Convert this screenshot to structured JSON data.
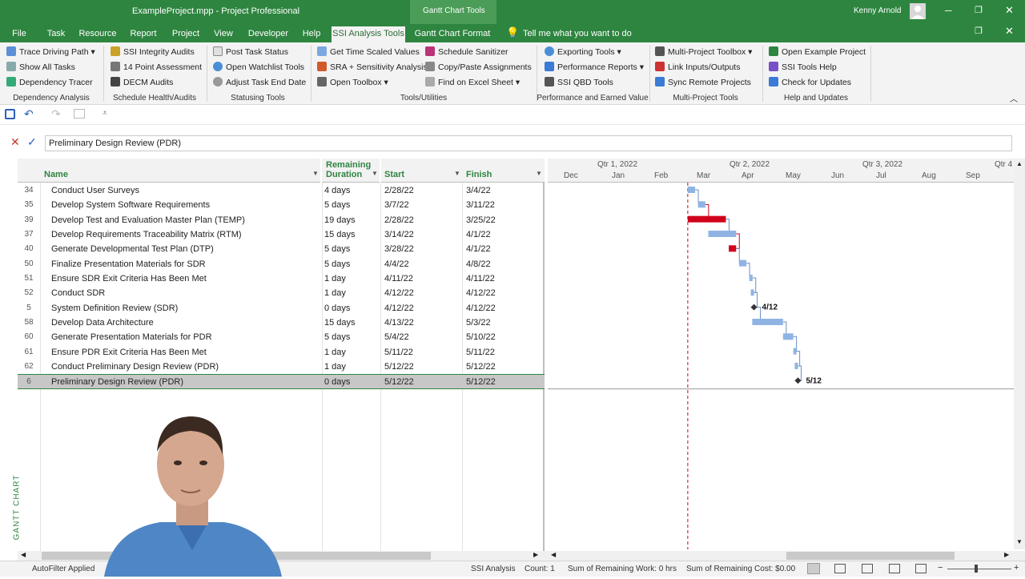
{
  "window": {
    "title": "ExampleProject.mpp  -  Project Professional",
    "context_tab_group": "Gantt Chart Tools",
    "user": "Kenny Arnold"
  },
  "tabs": [
    {
      "label": "File"
    },
    {
      "label": "Task"
    },
    {
      "label": "Resource"
    },
    {
      "label": "Report"
    },
    {
      "label": "Project"
    },
    {
      "label": "View"
    },
    {
      "label": "Developer"
    },
    {
      "label": "Help"
    },
    {
      "label": "SSI Analysis Tools",
      "active": true
    },
    {
      "label": "Gantt Chart Format"
    }
  ],
  "tell_me": "Tell me what you want to do",
  "ribbon": {
    "groups": [
      {
        "label": "Dependency Analysis",
        "items": [
          "Trace Driving Path",
          "Show All Tasks",
          "Dependency Tracer"
        ]
      },
      {
        "label": "Schedule Health/Audits",
        "items": [
          "SSI Integrity Audits",
          "14 Point Assessment",
          "DECM Audits"
        ]
      },
      {
        "label": "Statusing Tools",
        "items": [
          "Post Task Status",
          "Open Watchlist Tools",
          "Adjust Task End Date"
        ]
      },
      {
        "label": "Tools/Utilities",
        "items": [
          "Get Time Scaled Values",
          "SRA + Sensitivity Analysis",
          "Open Toolbox",
          "Schedule Sanitizer",
          "Copy/Paste Assignments",
          "Find on Excel Sheet"
        ]
      },
      {
        "label": "Performance and Earned Value",
        "items": [
          "Exporting Tools",
          "Performance Reports",
          "SSI QBD Tools"
        ]
      },
      {
        "label": "Multi-Project Tools",
        "items": [
          "Multi-Project Toolbox",
          "Link Inputs/Outputs",
          "Sync Remote Projects"
        ]
      },
      {
        "label": "Help and Updates",
        "items": [
          "Open Example Project",
          "SSI Tools Help",
          "Check for Updates"
        ]
      }
    ]
  },
  "entry_bar": {
    "value": "Preliminary Design Review (PDR)"
  },
  "view_label": "GANTT CHART",
  "table": {
    "columns": {
      "name": "Name",
      "remaining": "Remaining Duration",
      "start": "Start",
      "finish": "Finish"
    },
    "rows": [
      {
        "id": "34",
        "name": "Conduct User Surveys",
        "remaining": "4 days",
        "start": "2/28/22",
        "finish": "3/4/22"
      },
      {
        "id": "35",
        "name": "Develop System Software Requirements",
        "remaining": "5 days",
        "start": "3/7/22",
        "finish": "3/11/22"
      },
      {
        "id": "39",
        "name": "Develop Test and Evaluation Master Plan (TEMP)",
        "remaining": "19 days",
        "start": "2/28/22",
        "finish": "3/25/22"
      },
      {
        "id": "37",
        "name": "Develop Requirements Traceability Matrix (RTM)",
        "remaining": "15 days",
        "start": "3/14/22",
        "finish": "4/1/22"
      },
      {
        "id": "40",
        "name": "Generate Developmental Test Plan (DTP)",
        "remaining": "5 days",
        "start": "3/28/22",
        "finish": "4/1/22"
      },
      {
        "id": "50",
        "name": "Finalize Presentation Materials for SDR",
        "remaining": "5 days",
        "start": "4/4/22",
        "finish": "4/8/22"
      },
      {
        "id": "51",
        "name": "Ensure SDR Exit Criteria Has Been Met",
        "remaining": "1 day",
        "start": "4/11/22",
        "finish": "4/11/22"
      },
      {
        "id": "52",
        "name": "Conduct SDR",
        "remaining": "1 day",
        "start": "4/12/22",
        "finish": "4/12/22"
      },
      {
        "id": "5",
        "name": "System Definition Review (SDR)",
        "remaining": "0 days",
        "start": "4/12/22",
        "finish": "4/12/22"
      },
      {
        "id": "58",
        "name": "Develop Data Architecture",
        "remaining": "15 days",
        "start": "4/13/22",
        "finish": "5/3/22"
      },
      {
        "id": "60",
        "name": "Generate Presentation Materials for PDR",
        "remaining": "5 days",
        "start": "5/4/22",
        "finish": "5/10/22"
      },
      {
        "id": "61",
        "name": "Ensure PDR Exit Criteria Has Been Met",
        "remaining": "1 day",
        "start": "5/11/22",
        "finish": "5/11/22"
      },
      {
        "id": "62",
        "name": "Conduct Preliminary Design Review (PDR)",
        "remaining": "1 day",
        "start": "5/12/22",
        "finish": "5/12/22"
      },
      {
        "id": "6",
        "name": "Preliminary Design Review (PDR)",
        "remaining": "0 days",
        "start": "5/12/22",
        "finish": "5/12/22",
        "selected": true
      }
    ]
  },
  "timescale": {
    "quarters": [
      "Qtr 1, 2022",
      "Qtr 2, 2022",
      "Qtr 3, 2022",
      "Qtr 4"
    ],
    "months": [
      "Dec",
      "Jan",
      "Feb",
      "Mar",
      "Apr",
      "May",
      "Jun",
      "Jul",
      "Aug",
      "Sep"
    ]
  },
  "gantt_bars": [
    {
      "start": "2/28/22",
      "finish": "3/4/22",
      "critical": false
    },
    {
      "start": "3/7/22",
      "finish": "3/11/22",
      "critical": false
    },
    {
      "start": "2/28/22",
      "finish": "3/25/22",
      "critical": true
    },
    {
      "start": "3/14/22",
      "finish": "4/1/22",
      "critical": false
    },
    {
      "start": "3/28/22",
      "finish": "4/1/22",
      "critical": true
    },
    {
      "start": "4/4/22",
      "finish": "4/8/22",
      "critical": false
    },
    {
      "start": "4/11/22",
      "finish": "4/11/22",
      "critical": false
    },
    {
      "start": "4/12/22",
      "finish": "4/12/22",
      "critical": false
    },
    {
      "start": "4/12/22",
      "finish": "4/12/22",
      "milestone": true,
      "label": "4/12"
    },
    {
      "start": "4/13/22",
      "finish": "5/3/22",
      "critical": false
    },
    {
      "start": "5/4/22",
      "finish": "5/10/22",
      "critical": false
    },
    {
      "start": "5/11/22",
      "finish": "5/11/22",
      "critical": false
    },
    {
      "start": "5/12/22",
      "finish": "5/12/22",
      "critical": false
    },
    {
      "start": "5/12/22",
      "finish": "5/12/22",
      "milestone": true,
      "label": "5/12"
    }
  ],
  "status_bar": {
    "autofilter": "AutoFilter Applied",
    "view": "SSI Analysis",
    "count": "Count: 1",
    "sum_work": "Sum of Remaining Work: 0 hrs",
    "sum_cost": "Sum of Remaining Cost: $0.00"
  },
  "colors": {
    "accent": "#2e8540",
    "bar": "#8fb4e3",
    "critical": "#d0021b",
    "status_date": "#d0021b"
  }
}
